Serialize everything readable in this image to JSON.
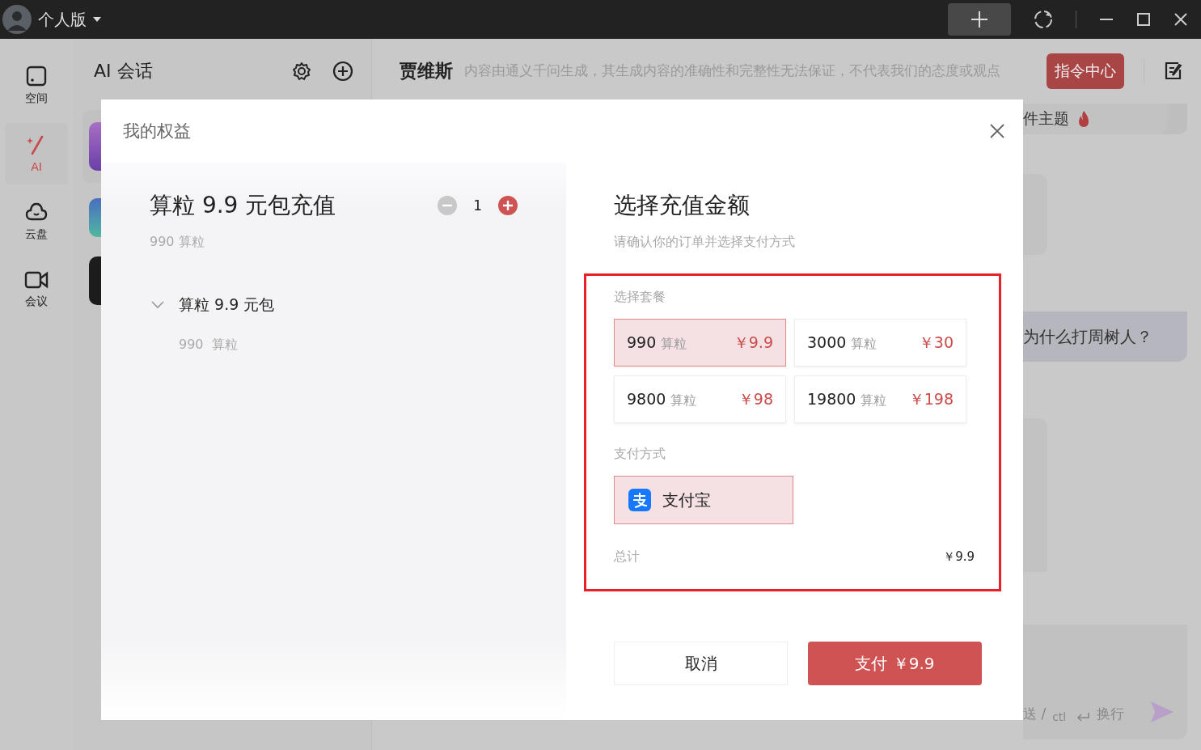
{
  "titlebar": {
    "edition": "个人版"
  },
  "rail": [
    {
      "label": "空间",
      "kind": "square",
      "selected": false
    },
    {
      "label": "AI",
      "kind": "wand",
      "selected": true
    },
    {
      "label": "云盘",
      "kind": "cloud",
      "selected": false
    },
    {
      "label": "会议",
      "kind": "camera",
      "selected": false
    }
  ],
  "session_panel": {
    "title": "AI 会话"
  },
  "chat": {
    "assistant": "贾维斯",
    "disclaimer": "内容由通义千问生成，其生成内容的准确性和完整性无法保证，不代表我们的态度或观点",
    "command_button": "指令中心",
    "topic": "件主题",
    "question": "为什么打周树人？",
    "hint_send": "送 /",
    "hint_ctl": "ctl",
    "hint_newline": "换行"
  },
  "dialog": {
    "title": "我的权益",
    "product": {
      "name": "算粒 9.9 元包充值",
      "subtitle": "990 算粒",
      "quantity": "1",
      "minus_disabled": true
    },
    "items": [
      {
        "name": "算粒 9.9 元包",
        "expanded": true,
        "amount": "990",
        "unit": "算粒"
      }
    ],
    "heading": "选择充值金额",
    "subheading": "请确认你的订单并选择支付方式",
    "package_label": "选择套餐",
    "packages": [
      {
        "amount": "990",
        "unit": "算粒",
        "price": "￥9.9",
        "selected": true
      },
      {
        "amount": "3000",
        "unit": "算粒",
        "price": "￥30",
        "selected": false
      },
      {
        "amount": "9800",
        "unit": "算粒",
        "price": "￥98",
        "selected": false
      },
      {
        "amount": "19800",
        "unit": "算粒",
        "price": "￥198",
        "selected": false
      }
    ],
    "payment_label": "支付方式",
    "payments": [
      {
        "label": "支付宝",
        "selected": true
      }
    ],
    "total_label": "总计",
    "total": "￥9.9",
    "cancel": "取消",
    "pay": "支付 ￥9.9"
  }
}
